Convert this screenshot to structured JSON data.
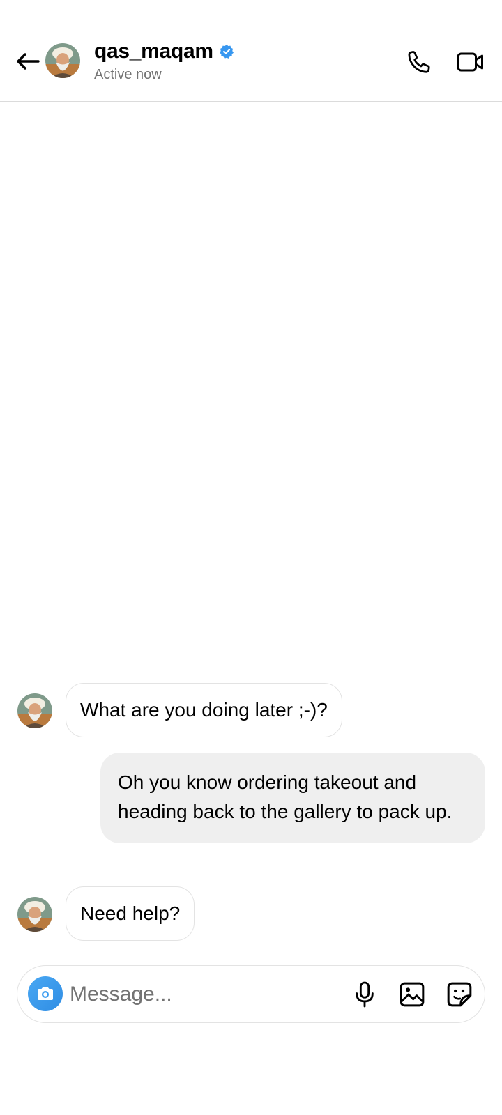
{
  "header": {
    "username": "qas_maqam",
    "status": "Active now",
    "verified": true,
    "icons": {
      "back": "arrow-left-icon",
      "call": "phone-icon",
      "video": "video-camera-icon",
      "verified": "verified-badge-icon"
    }
  },
  "messages": [
    {
      "direction": "incoming",
      "text": "What are you doing later ;-)?"
    },
    {
      "direction": "outgoing",
      "text": "Oh you know ordering takeout and heading back to the gallery to pack up."
    },
    {
      "direction": "incoming",
      "text": "Need help?"
    }
  ],
  "composer": {
    "placeholder": "Message...",
    "icons": [
      "camera-icon",
      "microphone-icon",
      "image-icon",
      "sticker-icon"
    ]
  },
  "colors": {
    "verified_blue": "#3797f0",
    "camera_button": "#3d9df0",
    "outgoing_bubble": "#efefef",
    "incoming_border": "#e3e3e3",
    "secondary_text": "#737373"
  }
}
